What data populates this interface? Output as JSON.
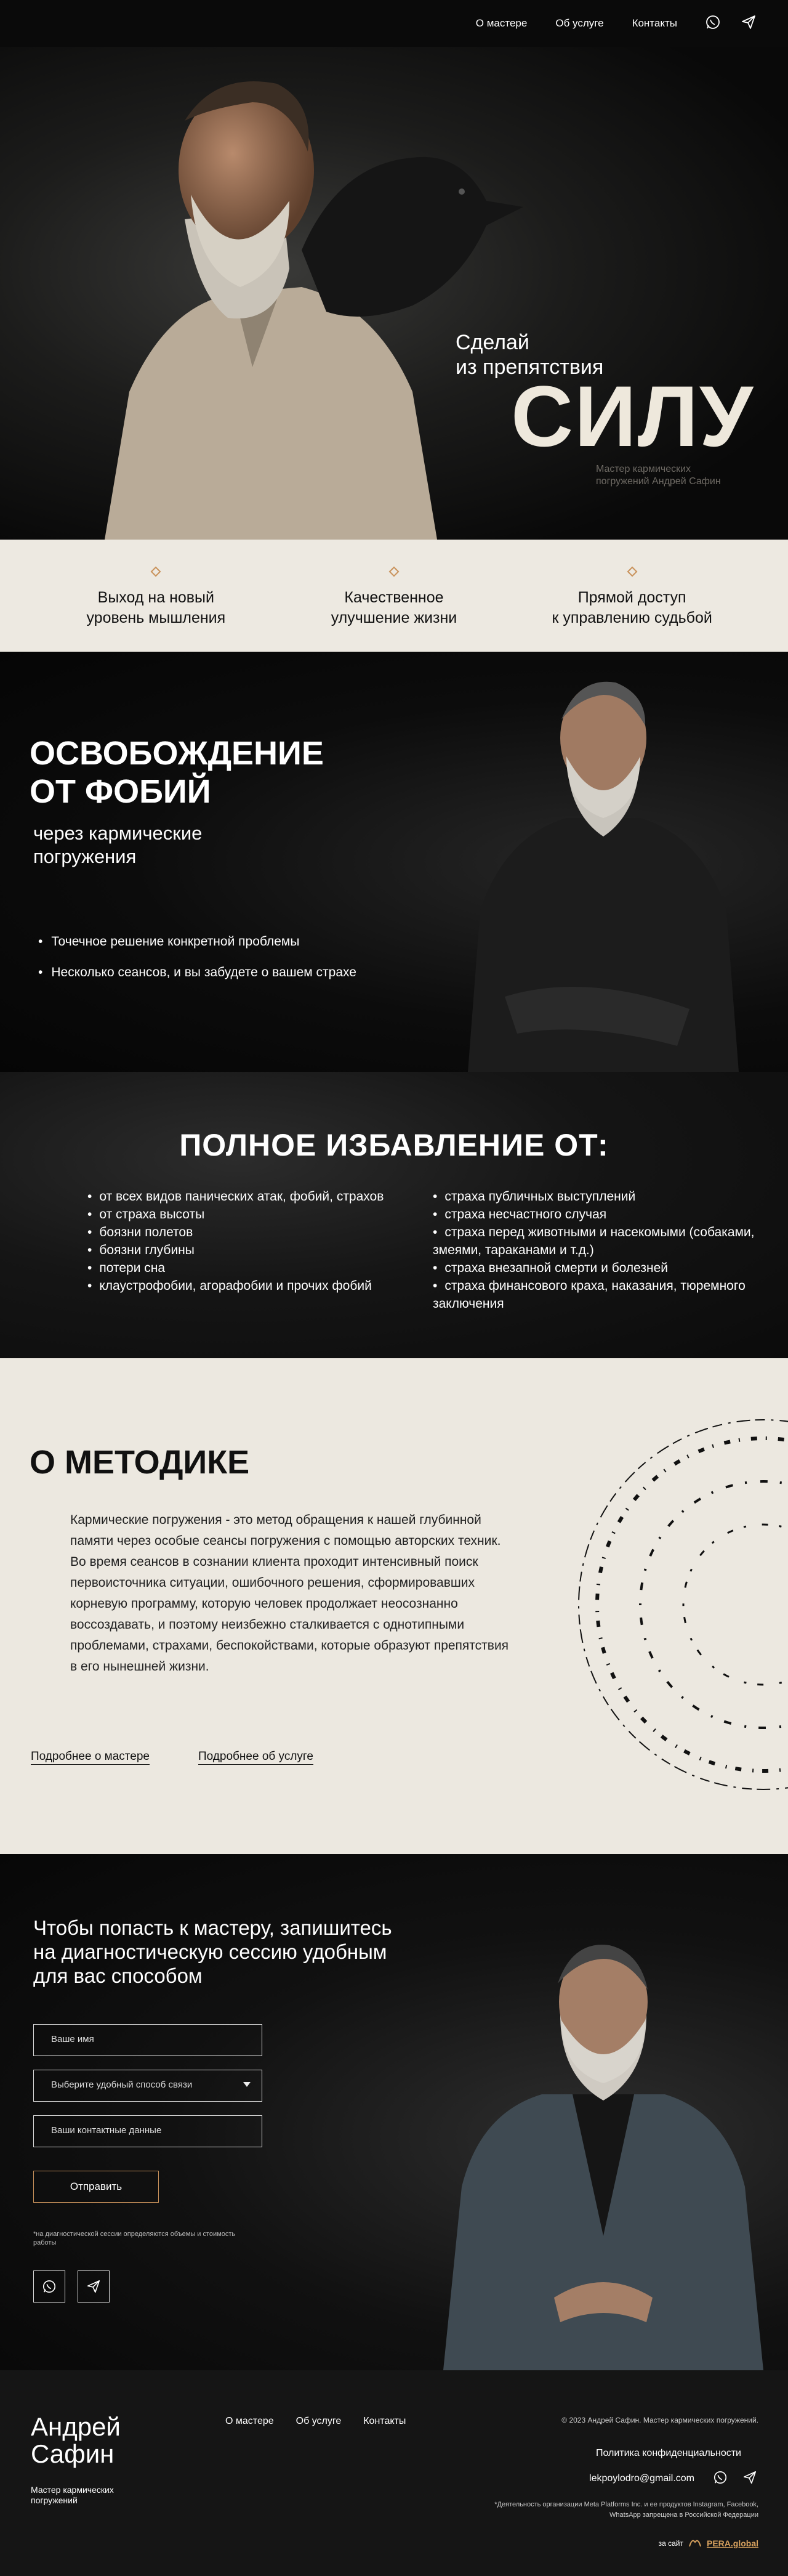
{
  "header": {
    "nav": [
      "О мастере",
      "Об услуге",
      "Контакты"
    ],
    "icons": [
      "whatsapp-icon",
      "telegram-icon"
    ]
  },
  "hero": {
    "tagline": "Сделай\nиз препятствия",
    "big_word": "СИЛУ",
    "subtitle": "Мастер кармических погружений Андрей Сафин"
  },
  "benefits": [
    "Выход на новый\nуровень мышления",
    "Качественное\nулучшение жизни",
    "Прямой доступ\nк управлению судьбой"
  ],
  "phobia": {
    "title": "ОСВОБОЖДЕНИЕ\nОТ ФОБИЙ",
    "subtitle": "через кармические\nпогружения",
    "points": [
      "Точечное решение конкретной проблемы",
      "Несколько сеансов, и вы забудете о вашем страхе"
    ]
  },
  "liberation": {
    "title": "ПОЛНОЕ ИЗБАВЛЕНИЕ ОТ:",
    "left": [
      "от всех видов панических атак, фобий, страхов",
      "от страха высоты",
      "боязни полетов",
      "боязни глубины",
      "потери сна",
      "клаустрофобии, агорафобии и прочих фобий"
    ],
    "right": [
      "страха публичных выступлений",
      "страха несчастного случая",
      "страха перед животными и насекомыми (собаками, змеями, тараканами и т.д.)",
      "страха внезапной смерти и болезней",
      "страха финансового краха, наказания, тюремного заключения"
    ]
  },
  "method": {
    "title": "О МЕТОДИКЕ",
    "text": "Кармические погружения - это метод обращения к нашей глубинной памяти через особые сеансы погружения с помощью авторских техник. Во время сеансов в сознании клиента проходит интенсивный поиск первоисточника ситуации, ошибочного решения, сформировавших корневую программу, которую человек продолжает неосознанно воссоздавать, и поэтому неизбежно сталкивается с однотипными проблемами, страхами, беспокойствами, которые образуют препятствия в его нынешней жизни.",
    "link1": "Подробнее о мастере",
    "link2": "Подробнее об услуге"
  },
  "contact": {
    "title": "Чтобы попасть к мастеру, запишитесь на диагностическую сессию удобным для вас способом",
    "name_placeholder": "Ваше имя",
    "method_placeholder": "Выберите удобный способ связи",
    "contact_placeholder": "Ваши контактные данные",
    "submit": "Отправить",
    "note": "*на диагностической сессии определяются объемы и стоимость работы"
  },
  "footer": {
    "name": "Андрей\nСафин",
    "role": "Мастер кармических погружений",
    "nav": [
      "О мастере",
      "Об услуге",
      "Контакты"
    ],
    "copyright": "© 2023 Андрей Сафин. Мастер кармических погружений.",
    "policy": "Политика конфиденциальности",
    "email": "lekpoylodro@gmail.com",
    "disclaimer": "*Деятельность организации Meta Platforms Inc. и ее продуктов Instagram, Facebook, WhatsApp запрещена в Российской Федерации",
    "site_prefix": "за сайт",
    "site_link": "PERA.global"
  },
  "colors": {
    "accent": "#c9925b",
    "cream": "#ede9e1",
    "dark": "#0d0d0d"
  }
}
